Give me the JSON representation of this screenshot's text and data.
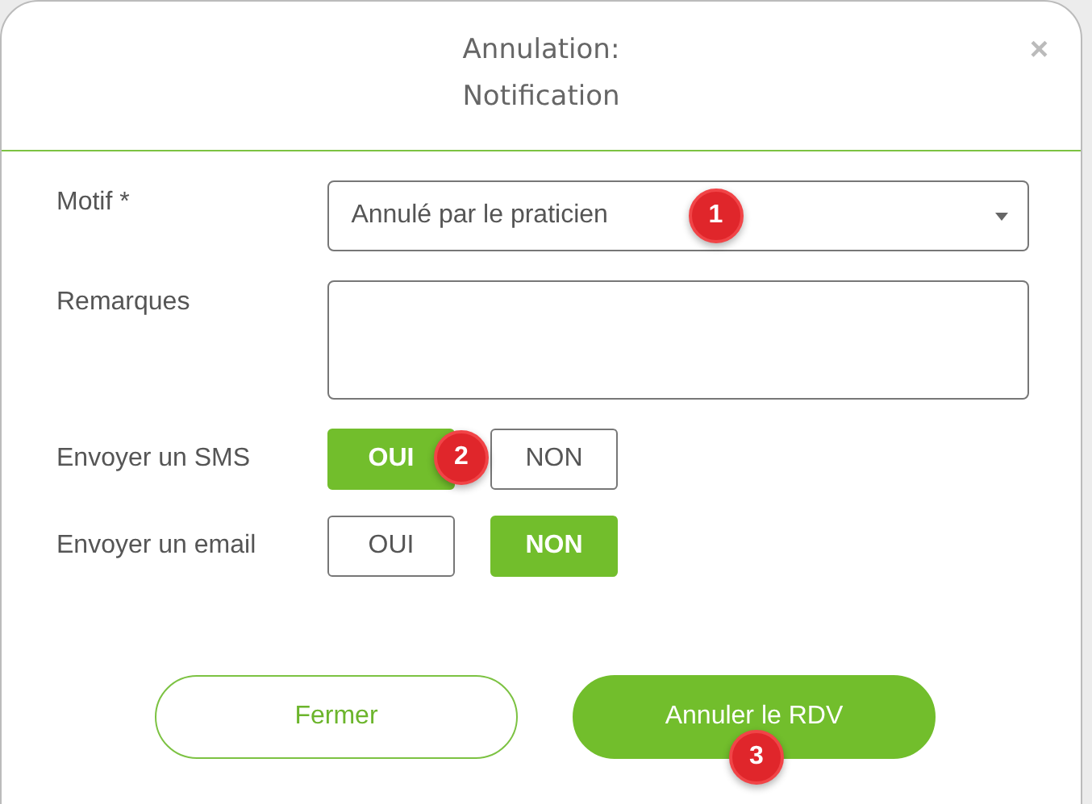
{
  "dialog": {
    "title_lines": [
      "Annulation:",
      "Notification"
    ],
    "close": "×"
  },
  "fields": [
    {
      "kind": "select",
      "label": "Motif *",
      "value": "Annulé par le praticien",
      "marker": "1"
    },
    {
      "kind": "textarea",
      "label": "Remarques"
    },
    {
      "kind": "toggle",
      "label": "Envoyer un SMS",
      "marker": "2",
      "options": [
        {
          "label": "OUI",
          "selected": true
        },
        {
          "label": "NON",
          "selected": false
        }
      ]
    },
    {
      "kind": "toggle",
      "label": "Envoyer un email",
      "options": [
        {
          "label": "OUI",
          "selected": false
        },
        {
          "label": "NON",
          "selected": true
        }
      ]
    }
  ],
  "buttons": [
    {
      "label": "Fermer",
      "kind": "outline"
    },
    {
      "label": "Annuler le RDV",
      "kind": "primary",
      "marker": "3"
    }
  ]
}
